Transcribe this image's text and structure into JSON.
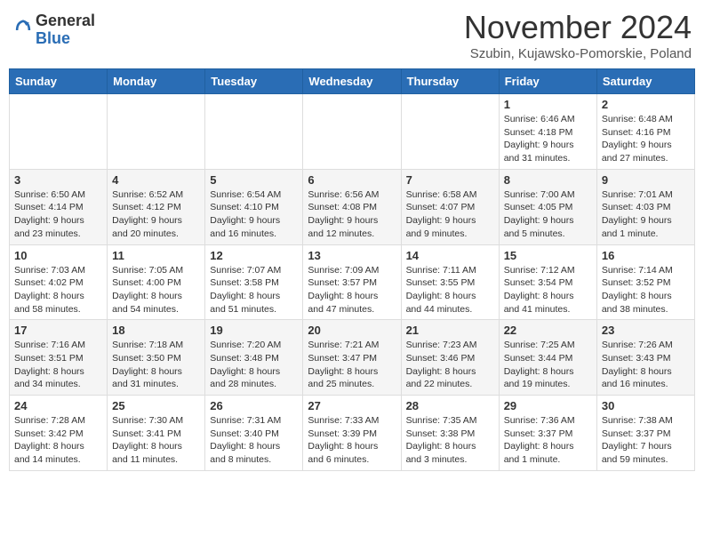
{
  "logo": {
    "general": "General",
    "blue": "Blue"
  },
  "title": "November 2024",
  "location": "Szubin, Kujawsko-Pomorskie, Poland",
  "days_of_week": [
    "Sunday",
    "Monday",
    "Tuesday",
    "Wednesday",
    "Thursday",
    "Friday",
    "Saturday"
  ],
  "weeks": [
    [
      {
        "day": "",
        "info": ""
      },
      {
        "day": "",
        "info": ""
      },
      {
        "day": "",
        "info": ""
      },
      {
        "day": "",
        "info": ""
      },
      {
        "day": "",
        "info": ""
      },
      {
        "day": "1",
        "info": "Sunrise: 6:46 AM\nSunset: 4:18 PM\nDaylight: 9 hours and 31 minutes."
      },
      {
        "day": "2",
        "info": "Sunrise: 6:48 AM\nSunset: 4:16 PM\nDaylight: 9 hours and 27 minutes."
      }
    ],
    [
      {
        "day": "3",
        "info": "Sunrise: 6:50 AM\nSunset: 4:14 PM\nDaylight: 9 hours and 23 minutes."
      },
      {
        "day": "4",
        "info": "Sunrise: 6:52 AM\nSunset: 4:12 PM\nDaylight: 9 hours and 20 minutes."
      },
      {
        "day": "5",
        "info": "Sunrise: 6:54 AM\nSunset: 4:10 PM\nDaylight: 9 hours and 16 minutes."
      },
      {
        "day": "6",
        "info": "Sunrise: 6:56 AM\nSunset: 4:08 PM\nDaylight: 9 hours and 12 minutes."
      },
      {
        "day": "7",
        "info": "Sunrise: 6:58 AM\nSunset: 4:07 PM\nDaylight: 9 hours and 9 minutes."
      },
      {
        "day": "8",
        "info": "Sunrise: 7:00 AM\nSunset: 4:05 PM\nDaylight: 9 hours and 5 minutes."
      },
      {
        "day": "9",
        "info": "Sunrise: 7:01 AM\nSunset: 4:03 PM\nDaylight: 9 hours and 1 minute."
      }
    ],
    [
      {
        "day": "10",
        "info": "Sunrise: 7:03 AM\nSunset: 4:02 PM\nDaylight: 8 hours and 58 minutes."
      },
      {
        "day": "11",
        "info": "Sunrise: 7:05 AM\nSunset: 4:00 PM\nDaylight: 8 hours and 54 minutes."
      },
      {
        "day": "12",
        "info": "Sunrise: 7:07 AM\nSunset: 3:58 PM\nDaylight: 8 hours and 51 minutes."
      },
      {
        "day": "13",
        "info": "Sunrise: 7:09 AM\nSunset: 3:57 PM\nDaylight: 8 hours and 47 minutes."
      },
      {
        "day": "14",
        "info": "Sunrise: 7:11 AM\nSunset: 3:55 PM\nDaylight: 8 hours and 44 minutes."
      },
      {
        "day": "15",
        "info": "Sunrise: 7:12 AM\nSunset: 3:54 PM\nDaylight: 8 hours and 41 minutes."
      },
      {
        "day": "16",
        "info": "Sunrise: 7:14 AM\nSunset: 3:52 PM\nDaylight: 8 hours and 38 minutes."
      }
    ],
    [
      {
        "day": "17",
        "info": "Sunrise: 7:16 AM\nSunset: 3:51 PM\nDaylight: 8 hours and 34 minutes."
      },
      {
        "day": "18",
        "info": "Sunrise: 7:18 AM\nSunset: 3:50 PM\nDaylight: 8 hours and 31 minutes."
      },
      {
        "day": "19",
        "info": "Sunrise: 7:20 AM\nSunset: 3:48 PM\nDaylight: 8 hours and 28 minutes."
      },
      {
        "day": "20",
        "info": "Sunrise: 7:21 AM\nSunset: 3:47 PM\nDaylight: 8 hours and 25 minutes."
      },
      {
        "day": "21",
        "info": "Sunrise: 7:23 AM\nSunset: 3:46 PM\nDaylight: 8 hours and 22 minutes."
      },
      {
        "day": "22",
        "info": "Sunrise: 7:25 AM\nSunset: 3:44 PM\nDaylight: 8 hours and 19 minutes."
      },
      {
        "day": "23",
        "info": "Sunrise: 7:26 AM\nSunset: 3:43 PM\nDaylight: 8 hours and 16 minutes."
      }
    ],
    [
      {
        "day": "24",
        "info": "Sunrise: 7:28 AM\nSunset: 3:42 PM\nDaylight: 8 hours and 14 minutes."
      },
      {
        "day": "25",
        "info": "Sunrise: 7:30 AM\nSunset: 3:41 PM\nDaylight: 8 hours and 11 minutes."
      },
      {
        "day": "26",
        "info": "Sunrise: 7:31 AM\nSunset: 3:40 PM\nDaylight: 8 hours and 8 minutes."
      },
      {
        "day": "27",
        "info": "Sunrise: 7:33 AM\nSunset: 3:39 PM\nDaylight: 8 hours and 6 minutes."
      },
      {
        "day": "28",
        "info": "Sunrise: 7:35 AM\nSunset: 3:38 PM\nDaylight: 8 hours and 3 minutes."
      },
      {
        "day": "29",
        "info": "Sunrise: 7:36 AM\nSunset: 3:37 PM\nDaylight: 8 hours and 1 minute."
      },
      {
        "day": "30",
        "info": "Sunrise: 7:38 AM\nSunset: 3:37 PM\nDaylight: 7 hours and 59 minutes."
      }
    ]
  ]
}
